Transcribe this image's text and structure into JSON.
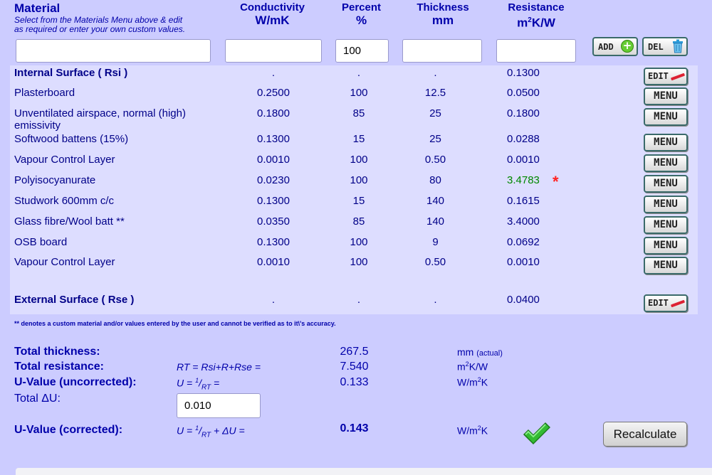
{
  "header": {
    "material_title": "Material",
    "material_sub1": "Select from the Materials Menu above & edit",
    "material_sub2": "as required or enter your own custom values.",
    "conductivity": "Conductivity",
    "conductivity_unit": "W/mK",
    "percent": "Percent",
    "percent_unit": "%",
    "thickness": "Thickness",
    "thickness_unit": "mm",
    "resistance": "Resistance",
    "resistance_unit_base": "m",
    "resistance_unit_sup": "2",
    "resistance_unit_rest": "K/W"
  },
  "entry": {
    "material_value": "",
    "conductivity_value": "",
    "percent_value": "100",
    "thickness_value": "",
    "resistance_value": "",
    "add_label": "ADD",
    "del_label": "DEL"
  },
  "rows": [
    {
      "material": "Internal Surface ( Rsi )",
      "conductivity": ".",
      "percent": ".",
      "thickness": ".",
      "resistance": "0.1300",
      "button": "EDIT"
    },
    {
      "material": "Plasterboard",
      "conductivity": "0.2500",
      "percent": "100",
      "thickness": "12.5",
      "resistance": "0.0500",
      "button": "MENU"
    },
    {
      "material": "Unventilated airspace, normal (high) emissivity",
      "conductivity": "0.1800",
      "percent": "85",
      "thickness": "25",
      "resistance": "0.1800",
      "button": "MENU"
    },
    {
      "material": "Softwood battens (15%)",
      "conductivity": "0.1300",
      "percent": "15",
      "thickness": "25",
      "resistance": "0.0288",
      "button": "MENU"
    },
    {
      "material": "Vapour Control Layer",
      "conductivity": "0.0010",
      "percent": "100",
      "thickness": "0.50",
      "resistance": "0.0010",
      "button": "MENU"
    },
    {
      "material": "Polyisocyanurate",
      "conductivity": "0.0230",
      "percent": "100",
      "thickness": "80",
      "resistance": "3.4783",
      "button": "MENU",
      "flag": "*"
    },
    {
      "material": "Studwork 600mm c/c",
      "conductivity": "0.1300",
      "percent": "15",
      "thickness": "140",
      "resistance": "0.1615",
      "button": "MENU"
    },
    {
      "material": "Glass fibre/Wool batt **",
      "conductivity": "0.0350",
      "percent": "85",
      "thickness": "140",
      "resistance": "3.4000",
      "button": "MENU"
    },
    {
      "material": "OSB board",
      "conductivity": "0.1300",
      "percent": "100",
      "thickness": "9",
      "resistance": "0.0692",
      "button": "MENU"
    },
    {
      "material": "Vapour Control Layer",
      "conductivity": "0.0010",
      "percent": "100",
      "thickness": "0.50",
      "resistance": "0.0010",
      "button": "MENU"
    },
    {
      "material": "External Surface ( Rse )",
      "conductivity": ".",
      "percent": ".",
      "thickness": ".",
      "resistance": "0.0400",
      "button": "EDIT"
    }
  ],
  "note": "** denotes a custom material and/or values entered by the user and cannot be verified as to it\\'s accuracy.",
  "summary": {
    "thickness_label": "Total thickness:",
    "thickness_value": "267.5",
    "thickness_unit": "mm",
    "thickness_unit_note": "(actual)",
    "resistance_label": "Total resistance:",
    "resistance_formula": "RT = Rsi+R+Rse =",
    "resistance_value": "7.540",
    "resistance_unit_base": "m",
    "resistance_unit_sup": "2",
    "resistance_unit_rest": "K/W",
    "uvalue_label": "U-Value (uncorrected):",
    "uvalue_formula_pre": "U = ",
    "uvalue_formula_sup": "1",
    "uvalue_formula_slash": "/",
    "uvalue_formula_sub": "RT",
    "uvalue_formula_post": " =",
    "uvalue_value": "0.133",
    "uvalue_unit_base": "W/m",
    "uvalue_unit_sup": "2",
    "uvalue_unit_rest": "K",
    "delta_label": "Total ΔU:",
    "delta_value": "0.010",
    "corrected_label": "U-Value (corrected):",
    "corrected_formula_post": "+ ΔU =",
    "corrected_value": "0.143",
    "recalc_label": "Recalculate"
  },
  "colors": {
    "background": "#ccccff",
    "table_bg": "#ddddff",
    "heading": "#0000aa",
    "highlight_value": "#008800",
    "flag": "#ff2222"
  }
}
